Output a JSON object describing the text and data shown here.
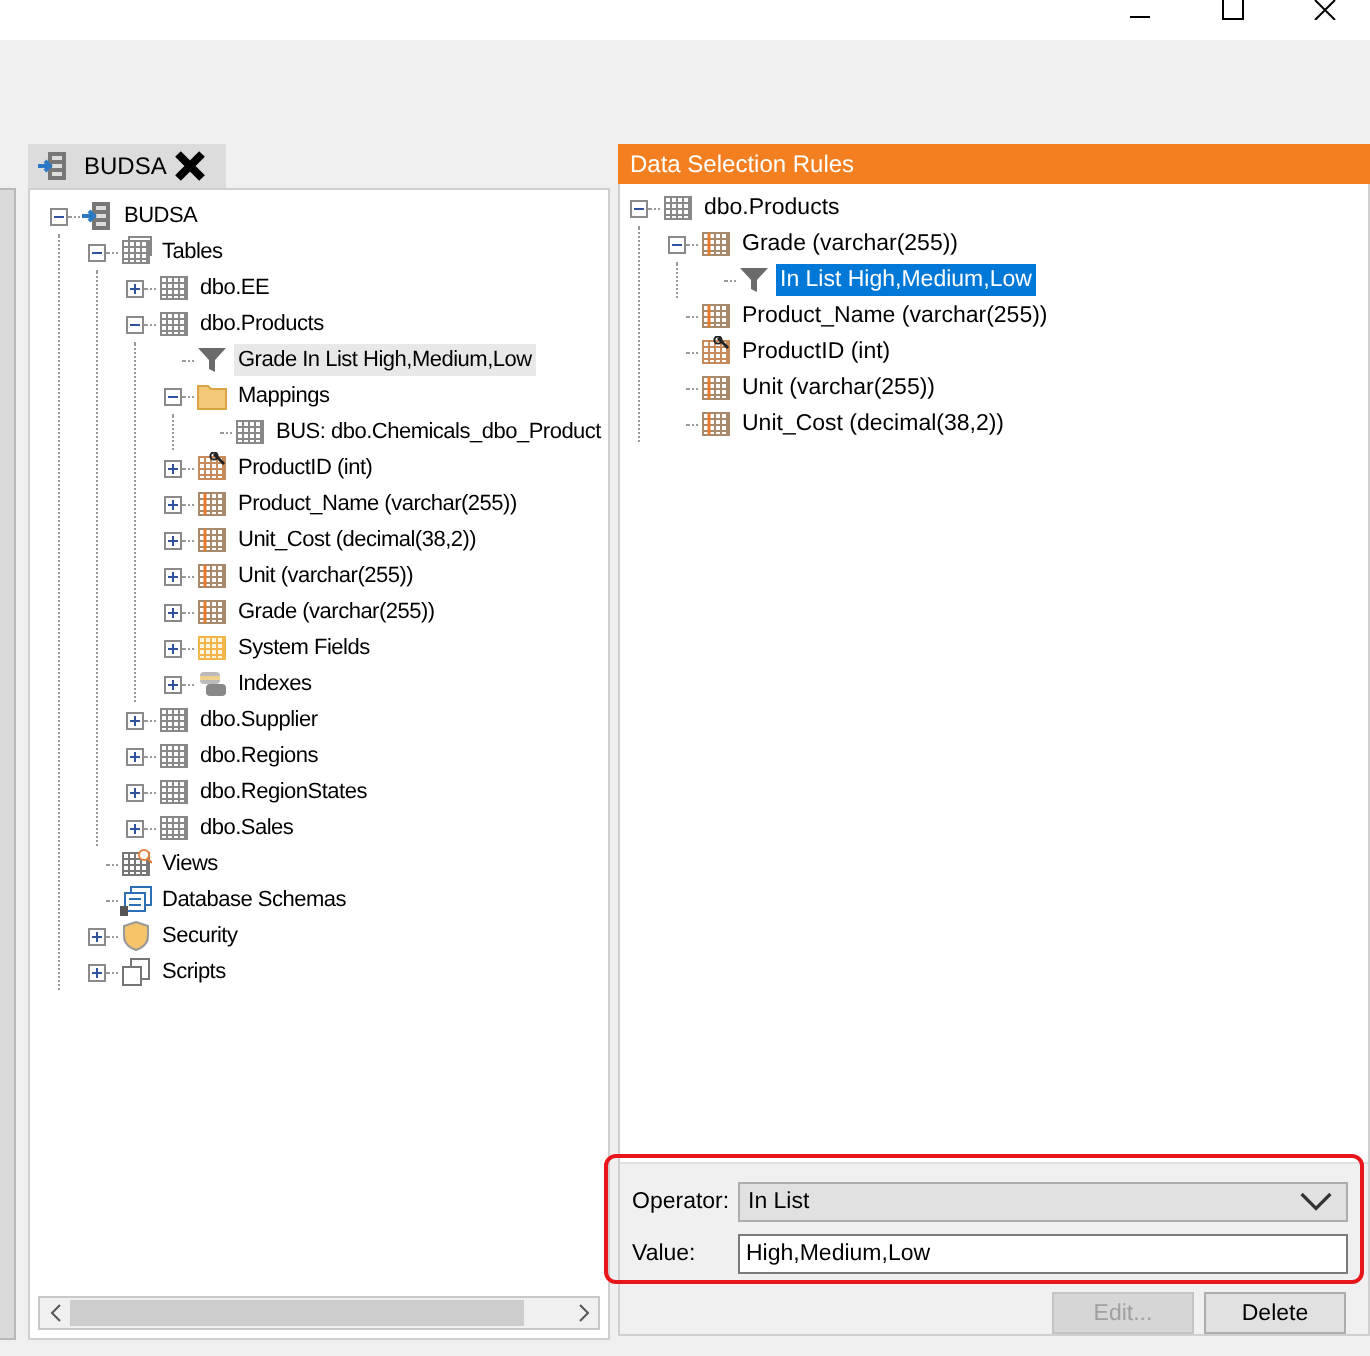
{
  "document_tab": {
    "label": "BUDSA",
    "selected": true
  },
  "schema_tree": {
    "focused": false,
    "nodes": [
      {
        "label": "BUDSA",
        "kind": "database",
        "expanded": true,
        "selected": false,
        "children": [
          {
            "label": "Tables",
            "kind": "tables",
            "expanded": true,
            "selected": false,
            "children": [
              {
                "label": "dbo.EE",
                "kind": "table",
                "expanded": false,
                "selected": false
              },
              {
                "label": "dbo.Products",
                "kind": "table",
                "expanded": true,
                "selected": false,
                "children": [
                  {
                    "label": "Grade In List High,Medium,Low",
                    "kind": "filter",
                    "selected": true
                  },
                  {
                    "label": "Mappings",
                    "kind": "folder",
                    "expanded": true,
                    "selected": false,
                    "children": [
                      {
                        "label": "BUS: dbo.Chemicals_dbo_Product",
                        "kind": "table",
                        "selected": false
                      }
                    ]
                  },
                  {
                    "label": "ProductID (int)",
                    "kind": "key",
                    "expanded": false,
                    "selected": false
                  },
                  {
                    "label": "Product_Name (varchar(255))",
                    "kind": "column",
                    "expanded": false,
                    "selected": false
                  },
                  {
                    "label": "Unit_Cost (decimal(38,2))",
                    "kind": "column",
                    "expanded": false,
                    "selected": false
                  },
                  {
                    "label": "Unit (varchar(255))",
                    "kind": "column",
                    "expanded": false,
                    "selected": false
                  },
                  {
                    "label": "Grade (varchar(255))",
                    "kind": "column",
                    "expanded": false,
                    "selected": false
                  },
                  {
                    "label": "System Fields",
                    "kind": "system",
                    "expanded": false,
                    "selected": false
                  },
                  {
                    "label": "Indexes",
                    "kind": "index",
                    "expanded": false,
                    "selected": false
                  }
                ]
              },
              {
                "label": "dbo.Supplier",
                "kind": "table",
                "expanded": false,
                "selected": false
              },
              {
                "label": "dbo.Regions",
                "kind": "table",
                "expanded": false,
                "selected": false
              },
              {
                "label": "dbo.RegionStates",
                "kind": "table",
                "expanded": false,
                "selected": false
              },
              {
                "label": "dbo.Sales",
                "kind": "table",
                "expanded": false,
                "selected": false
              }
            ]
          },
          {
            "label": "Views",
            "kind": "views",
            "selected": false
          },
          {
            "label": "Database Schemas",
            "kind": "schemas",
            "selected": false
          },
          {
            "label": "Security",
            "kind": "security",
            "expanded": false,
            "selected": false
          },
          {
            "label": "Scripts",
            "kind": "scripts",
            "expanded": false,
            "selected": false
          }
        ]
      }
    ]
  },
  "rules_panel": {
    "title": "Data Selection Rules",
    "tree": {
      "focused": true,
      "nodes": [
        {
          "label": "dbo.Products",
          "kind": "table",
          "expanded": true,
          "selected": false,
          "children": [
            {
              "label": "Grade (varchar(255))",
              "kind": "column",
              "expanded": true,
              "selected": false,
              "children": [
                {
                  "label": "In List High,Medium,Low",
                  "kind": "filter",
                  "selected": true
                }
              ]
            },
            {
              "label": "Product_Name (varchar(255))",
              "kind": "column",
              "selected": false
            },
            {
              "label": "ProductID (int)",
              "kind": "key",
              "selected": false
            },
            {
              "label": "Unit (varchar(255))",
              "kind": "column",
              "selected": false
            },
            {
              "label": "Unit_Cost (decimal(38,2))",
              "kind": "column",
              "selected": false
            }
          ]
        }
      ]
    },
    "operator": {
      "label": "Operator:",
      "value": "In List"
    },
    "value_field": {
      "label": "Value:",
      "value": "High,Medium,Low"
    },
    "buttons": [
      {
        "label": "Edit...",
        "disabled": true
      },
      {
        "label": "Delete",
        "disabled": false
      }
    ]
  }
}
